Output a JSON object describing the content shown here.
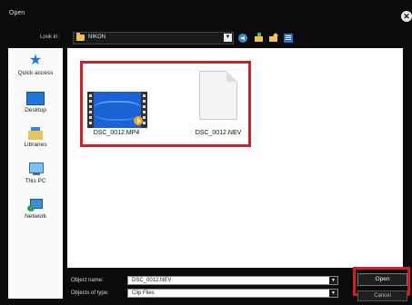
{
  "window": {
    "title": "Open",
    "close_glyph": "✕"
  },
  "lookin": {
    "label": "Look in:",
    "value": "NIKON",
    "drop_glyph": "▼"
  },
  "places": [
    {
      "label": "Quick access",
      "icon": "star-icon"
    },
    {
      "label": "Desktop",
      "icon": "desktop-icon"
    },
    {
      "label": "Libraries",
      "icon": "libraries-icon"
    },
    {
      "label": "This PC",
      "icon": "pc-icon"
    },
    {
      "label": "Network",
      "icon": "network-icon"
    }
  ],
  "files": [
    {
      "name": "DSC_0012.MP4",
      "type": "video"
    },
    {
      "name": "DSC_0012.NEV",
      "type": "document"
    }
  ],
  "object_name": {
    "label": "Object name:",
    "value": "DSC_0012.NEV"
  },
  "object_type": {
    "label": "Objects of type:",
    "value": "Clip Files"
  },
  "buttons": {
    "open": "Open",
    "cancel": "Cancel"
  },
  "colors": {
    "highlight": "#d01f2a",
    "accent": "#1f78d6",
    "background": "#0b0b0b"
  }
}
